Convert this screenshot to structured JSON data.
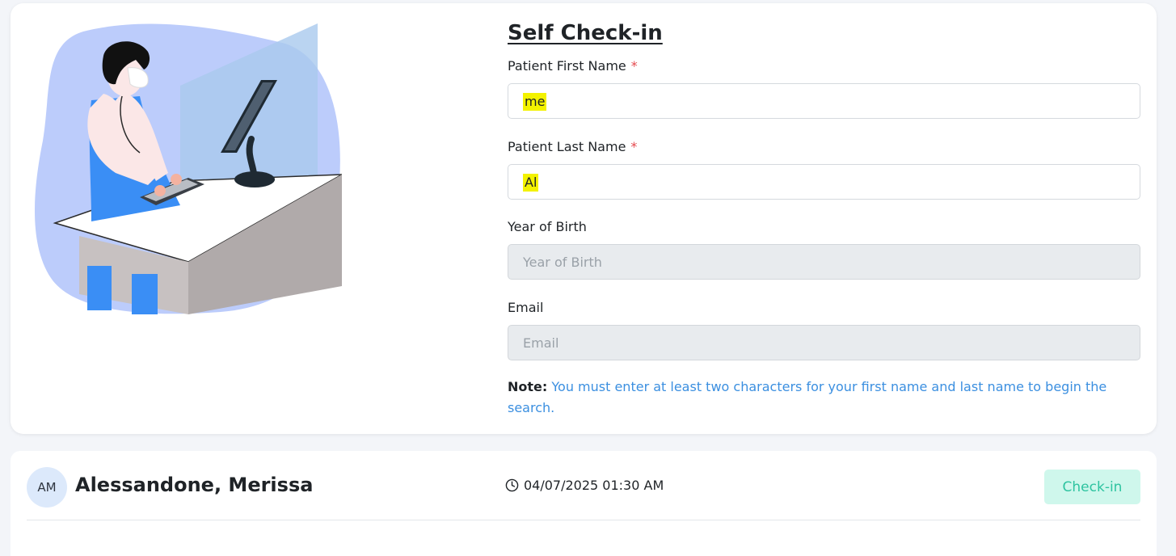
{
  "checkin": {
    "title": "Self Check-in",
    "required_mark": "*",
    "fields": {
      "first_name": {
        "label": "Patient First Name",
        "value": "me"
      },
      "last_name": {
        "label": "Patient Last Name",
        "value": "Al"
      },
      "year_of_birth": {
        "label": "Year of Birth",
        "placeholder": "Year of Birth"
      },
      "email": {
        "label": "Email",
        "placeholder": "Email"
      }
    },
    "note_label": "Note:",
    "note_text": "You must enter at least two characters for your first name and last name to begin the search."
  },
  "results": [
    {
      "initials": "AM",
      "name": "Alessandone, Merissa",
      "appointment": "04/07/2025 01:30 AM",
      "button_label": "Check-in"
    }
  ],
  "icons": {
    "clock": "clock-icon",
    "illustration": "receptionist-computer-illustration"
  },
  "colors": {
    "required": "#e5484d",
    "note": "#3b8fe0",
    "highlight": "#f3f200",
    "checkin_bg": "#cff7ec",
    "checkin_text": "#2ec3a0",
    "avatar_bg": "#dce9fb"
  }
}
